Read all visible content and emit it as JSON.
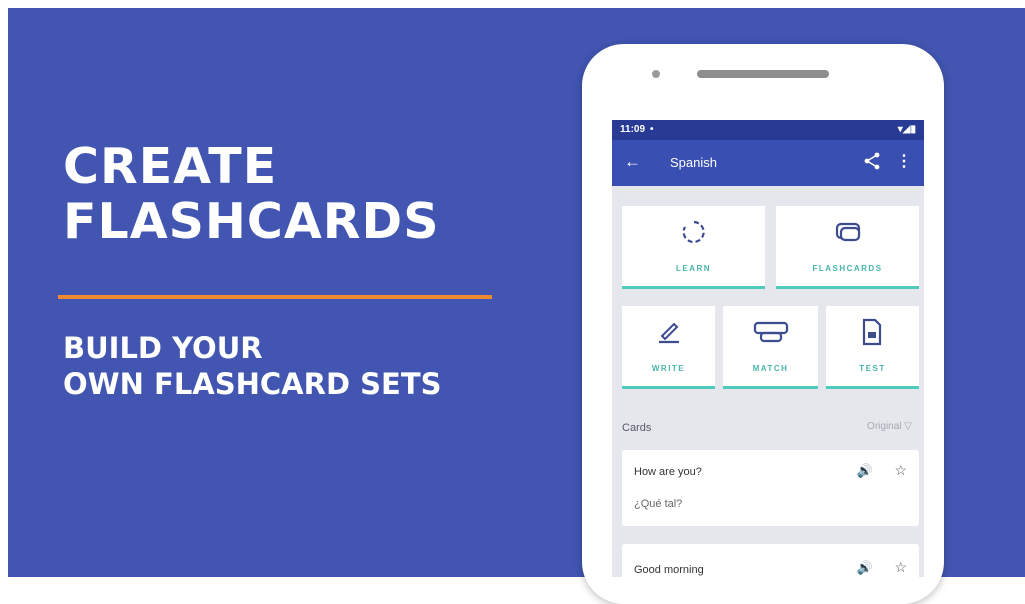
{
  "promo": {
    "headline": [
      "CREATE",
      "FLASHCARDS"
    ],
    "subheadline": [
      "BUILD YOUR",
      "OWN FLASHCARD SETS"
    ],
    "colors": {
      "background": "#4155b1",
      "divider": "#f08a2e",
      "text": "#ffffff"
    }
  },
  "status_bar": {
    "time": "11:09",
    "dot": "•",
    "icons": "▾◢▮"
  },
  "app_bar": {
    "title": "Spanish",
    "back_icon": "←",
    "more_icon": "⋮",
    "colors": {
      "app_bar": "#3a4fb2",
      "status_bar": "#283a94"
    }
  },
  "modes": [
    {
      "label": "LEARN",
      "icon": "learn-icon"
    },
    {
      "label": "FLASHCARDS",
      "icon": "flashcards-icon"
    },
    {
      "label": "WRITE",
      "icon": "write-icon"
    },
    {
      "label": "MATCH",
      "icon": "match-icon"
    },
    {
      "label": "TEST",
      "icon": "test-icon"
    }
  ],
  "cards_section": {
    "title": "Cards",
    "sort_label": "Original"
  },
  "cards": [
    {
      "term": "How are you?",
      "definition": "¿Qué tal?"
    },
    {
      "term": "Good morning",
      "definition": ""
    }
  ],
  "accent_color": "#4ecbbd"
}
